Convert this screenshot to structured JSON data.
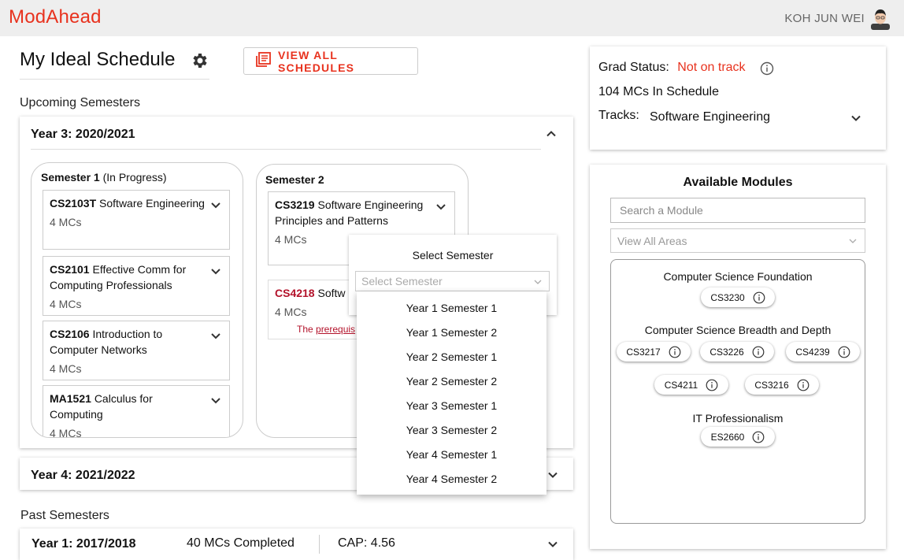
{
  "app": {
    "name": "ModAhead",
    "user_name": "KOH JUN WEI"
  },
  "header": {
    "page_title": "My Ideal Schedule",
    "view_all_label": "VIEW ALL SCHEDULES"
  },
  "upcoming": {
    "label": "Upcoming Semesters",
    "year3": {
      "title": "Year 3: 2020/2021",
      "sem1": {
        "title": "Semester 1",
        "status": "(In Progress)",
        "modules": [
          {
            "code": "CS2103T",
            "name": "Software Engineering",
            "mcs": "4 MCs"
          },
          {
            "code": "CS2101",
            "name": "Effective Comm for Computing Professionals",
            "mcs": "4 MCs"
          },
          {
            "code": "CS2106",
            "name": "Introduction to Computer Networks",
            "mcs": "4 MCs"
          },
          {
            "code": "MA1521",
            "name": "Calculus for Computing",
            "mcs": "4 MCs"
          }
        ]
      },
      "sem2": {
        "title": "Semester 2",
        "modules": [
          {
            "code": "CS3219",
            "name": "Software Engineering Principles and Patterns",
            "mcs": "4 MCs"
          },
          {
            "code": "CS4218",
            "name": "Softw",
            "mcs": "4 MCs",
            "warning_prefix": "The ",
            "warning_link": "prerequis"
          }
        ]
      }
    },
    "year4": {
      "title": "Year 4: 2021/2022"
    }
  },
  "past": {
    "label": "Past Semesters",
    "year1": {
      "title": "Year 1: 2017/2018",
      "mcs": "40 MCs Completed",
      "cap": "CAP: 4.56"
    }
  },
  "grad": {
    "status_label": "Grad Status:",
    "status_value": "Not on track",
    "mcs_line": "104 MCs In Schedule",
    "tracks_label": "Tracks:",
    "tracks_value": "Software Engineering"
  },
  "available": {
    "title": "Available Modules",
    "search_placeholder": "Search a Module",
    "area_select": "View All Areas",
    "areas": [
      {
        "title": "Computer Science Foundation",
        "modules": [
          "CS3230"
        ]
      },
      {
        "title": "Computer Science Breadth and Depth",
        "modules": [
          "CS3217",
          "CS3226",
          "CS4239",
          "CS4211",
          "CS3216"
        ]
      },
      {
        "title": "IT Professionalism",
        "modules": [
          "ES2660"
        ]
      }
    ]
  },
  "select_semester": {
    "title": "Select Semester",
    "placeholder": "Select Semester",
    "options": [
      "Year 1 Semester 1",
      "Year 1 Semester 2",
      "Year 2 Semester 1",
      "Year 2 Semester 2",
      "Year 3 Semester 1",
      "Year 3 Semester 2",
      "Year 4 Semester 1",
      "Year 4 Semester 2"
    ]
  },
  "colors": {
    "accent": "#e8321e",
    "warning": "#b3132b",
    "topbar": "#eeeeee"
  },
  "icons": [
    "gear-icon",
    "schedules-icon",
    "chevron-up-icon",
    "chevron-down-icon",
    "info-icon",
    "avatar"
  ]
}
